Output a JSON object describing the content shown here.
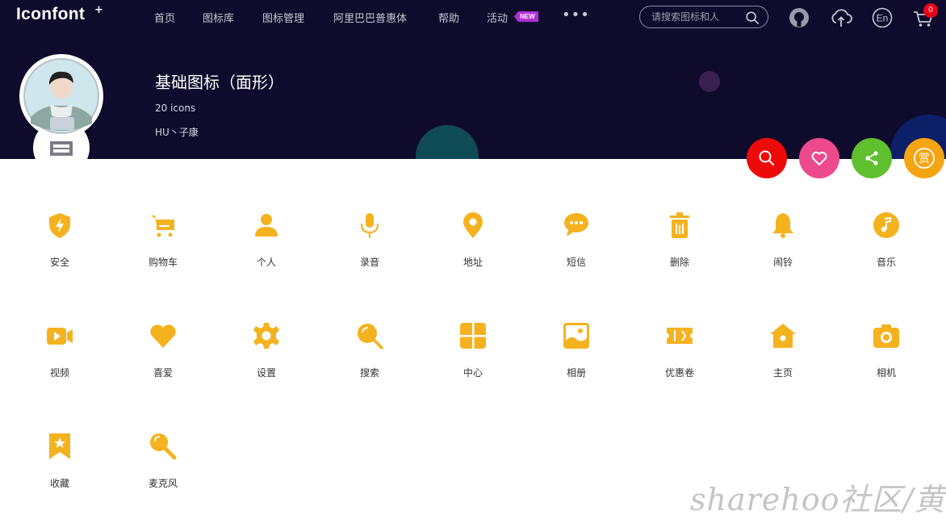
{
  "header": {
    "logo": "Iconfont",
    "logo_plus": "+",
    "nav": [
      "首页",
      "图标库",
      "图标管理",
      "阿里巴巴普惠体",
      "帮助",
      "活动"
    ],
    "new_badge": "NEW",
    "more": "•••",
    "search_placeholder": "请搜索图标和人",
    "icons": [
      "github-icon",
      "upload-cloud-icon",
      "language-en-icon",
      "cart-icon"
    ],
    "language_label": "En",
    "cart_count": "0"
  },
  "banner": {
    "title": "基础图标（面形）",
    "count": "20 icons",
    "author": "HU丶子康",
    "actions": [
      "search-icon",
      "heart-icon",
      "share-icon",
      "reward-icon"
    ],
    "reward_label": "赏",
    "action_colors": [
      "#ee0a0a",
      "#ec4a8d",
      "#5fbf2e",
      "#f5a512"
    ]
  },
  "icons": [
    {
      "label": "安全",
      "icon": "shield-icon"
    },
    {
      "label": "购物车",
      "icon": "cart-icon"
    },
    {
      "label": "个人",
      "icon": "user-icon"
    },
    {
      "label": "录音",
      "icon": "microphone-icon"
    },
    {
      "label": "地址",
      "icon": "location-pin-icon"
    },
    {
      "label": "短信",
      "icon": "chat-bubble-icon"
    },
    {
      "label": "删除",
      "icon": "trash-icon"
    },
    {
      "label": "闹铃",
      "icon": "bell-icon"
    },
    {
      "label": "音乐",
      "icon": "music-note-icon"
    },
    {
      "label": "视频",
      "icon": "video-camera-icon"
    },
    {
      "label": "喜爱",
      "icon": "heart-icon"
    },
    {
      "label": "设置",
      "icon": "gear-icon"
    },
    {
      "label": "搜索",
      "icon": "search-icon"
    },
    {
      "label": "中心",
      "icon": "grid-icon"
    },
    {
      "label": "相册",
      "icon": "image-icon"
    },
    {
      "label": "优惠卷",
      "icon": "coupon-icon"
    },
    {
      "label": "主页",
      "icon": "home-icon"
    },
    {
      "label": "相机",
      "icon": "camera-icon"
    },
    {
      "label": "收藏",
      "icon": "bookmark-star-icon"
    },
    {
      "label": "麦克风",
      "icon": "karaoke-microphone-icon"
    }
  ],
  "icon_color": "#f5b21f",
  "watermark": "sharehoo社区/黄小"
}
